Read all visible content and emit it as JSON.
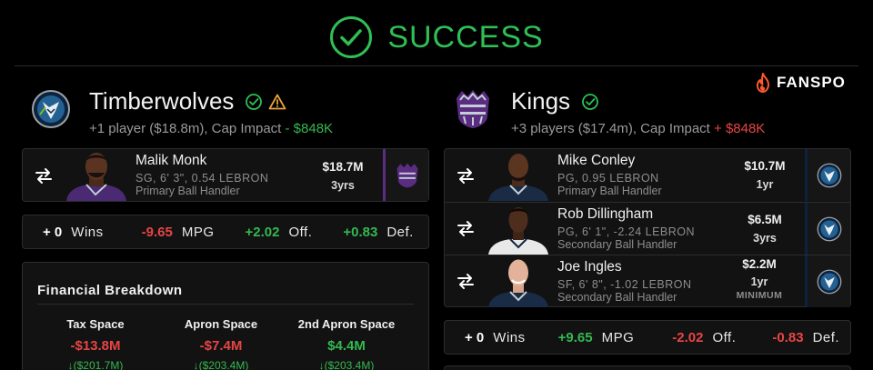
{
  "header": {
    "title": "SUCCESS"
  },
  "brand": {
    "name": "FANSPO"
  },
  "teams": [
    {
      "name": "Timberwolves",
      "summary_prefix": "+1 player ($18.8m), Cap Impact ",
      "cap_impact": "- $848K",
      "players": [
        {
          "name": "Malik Monk",
          "desc": "SG, 6' 3\", 0.54 LEBRON",
          "role": "Primary Ball Handler",
          "salary": "$18.7M",
          "years": "3yrs",
          "from_team": "kings-logo"
        }
      ],
      "stats": {
        "wins": "+ 0",
        "wins_label": "Wins",
        "mpg": "-9.65",
        "mpg_label": "MPG",
        "off": "+2.02",
        "off_label": "Off.",
        "def": "+0.83",
        "def_label": "Def."
      },
      "financial": {
        "title": "Financial Breakdown",
        "columns": [
          {
            "label": "Tax Space",
            "value": "-$13.8M",
            "sub": "↓($201.7M)"
          },
          {
            "label": "Apron Space",
            "value": "-$7.4M",
            "sub": "↓($203.4M)"
          },
          {
            "label": "2nd Apron Space",
            "value": "$4.4M",
            "sub": "↓($203.4M)"
          }
        ]
      }
    },
    {
      "name": "Kings",
      "summary_prefix": "+3 players ($17.4m), Cap Impact ",
      "cap_impact": "+ $848K",
      "players": [
        {
          "name": "Mike Conley",
          "desc": "PG, 0.95 LEBRON",
          "role": "Primary Ball Handler",
          "salary": "$10.7M",
          "years": "1yr",
          "from_team": "timberwolves-logo"
        },
        {
          "name": "Rob Dillingham",
          "desc": "PG, 6' 1\", -2.24 LEBRON",
          "role": "Secondary Ball Handler",
          "salary": "$6.5M",
          "years": "3yrs",
          "from_team": "timberwolves-logo"
        },
        {
          "name": "Joe Ingles",
          "desc": "SF, 6' 8\", -1.02 LEBRON",
          "role": "Secondary Ball Handler",
          "salary": "$2.2M",
          "years": "1yr",
          "note": "MINIMUM",
          "from_team": "timberwolves-logo"
        }
      ],
      "stats": {
        "wins": "+ 0",
        "wins_label": "Wins",
        "mpg": "+9.65",
        "mpg_label": "MPG",
        "off": "-2.02",
        "off_label": "Off.",
        "def": "-0.83",
        "def_label": "Def."
      }
    }
  ],
  "colors": {
    "success": "#2fbf55",
    "positive": "#34b850",
    "negative": "#e84545",
    "kings": "#5a2d82",
    "wolves": "#0c2340",
    "warning": "#e8a33d"
  }
}
